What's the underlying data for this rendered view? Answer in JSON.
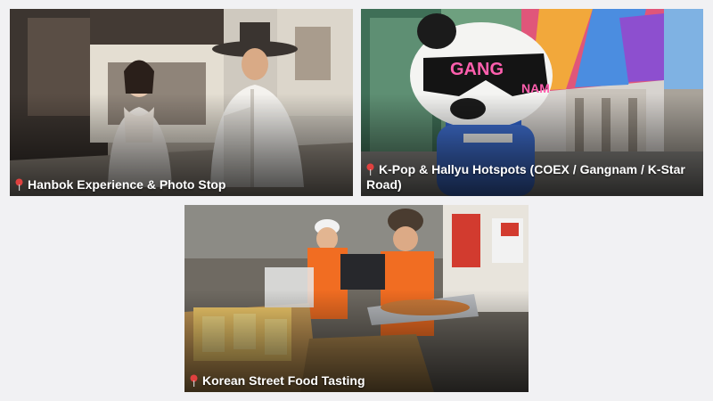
{
  "cards": [
    {
      "title": "Hanbok Experience & Photo Stop",
      "icon": "map-pin-icon"
    },
    {
      "title": "K-Pop & Hallyu Hotspots (COEX / Gangnam / K-Star Road)",
      "icon": "map-pin-icon",
      "sign_text_1": "GANG",
      "sign_text_2": "NAM"
    },
    {
      "title": "Korean Street Food Tasting",
      "icon": "map-pin-icon"
    }
  ],
  "colors": {
    "background": "#f1f1f3",
    "caption_text": "#ffffff",
    "pin": "#e0413f"
  }
}
